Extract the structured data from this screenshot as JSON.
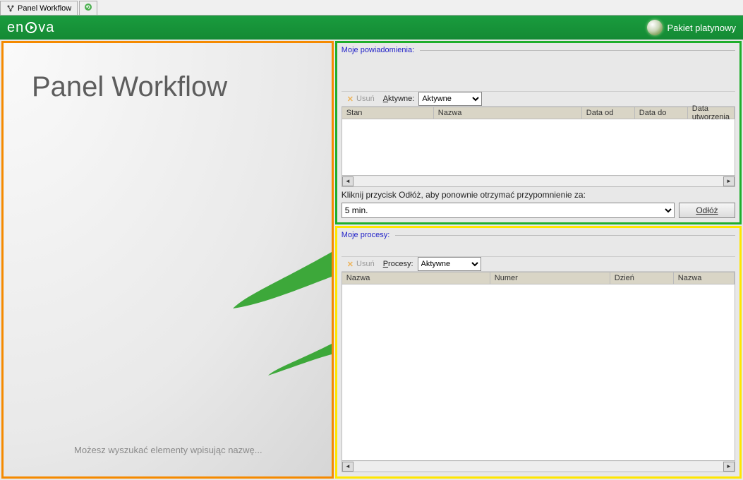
{
  "tabs": {
    "main_label": "Panel Workflow"
  },
  "header": {
    "logo_left": "en",
    "logo_right": "va",
    "package_label": "Pakiet platynowy"
  },
  "left": {
    "title": "Panel Workflow",
    "hint": "Możesz wyszukać elementy wpisując nazwę..."
  },
  "notifications": {
    "group_title": "Moje powiadomienia:",
    "delete_label": "Usuń",
    "filter_label": "Aktywne:",
    "filter_value": "Aktywne",
    "columns": [
      "Stan",
      "Nazwa",
      "Data od",
      "Data do",
      "Data utworzenia"
    ],
    "reminder_hint": "Kliknij przycisk Odłóż, aby ponownie otrzymać przypomnienie za:",
    "reminder_value": "5 min.",
    "postpone_label": "Odłóż"
  },
  "processes": {
    "group_title": "Moje procesy:",
    "delete_label": "Usuń",
    "filter_label": "Procesy:",
    "filter_value": "Aktywne",
    "columns": [
      "Nazwa",
      "Numer",
      "Dzień",
      "Nazwa"
    ]
  }
}
